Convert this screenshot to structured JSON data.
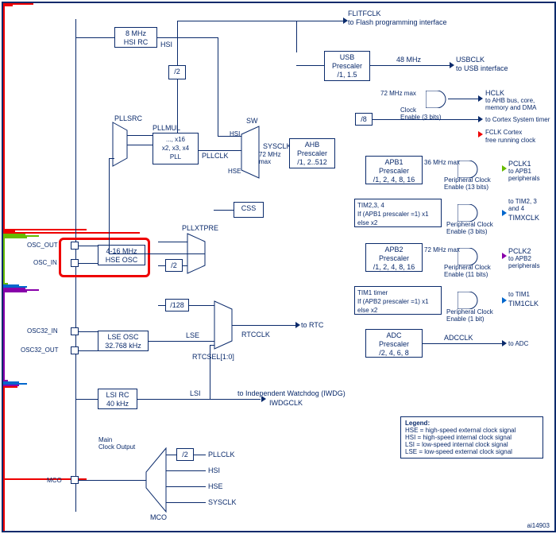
{
  "diagram_id": "ai14903",
  "sources": {
    "hsi": {
      "name": "8 MHz\nHSI RC",
      "signal": "HSI"
    },
    "hse": {
      "name": "4-16 MHz\nHSE OSC",
      "signal": "HSE",
      "pins": [
        "OSC_OUT",
        "OSC_IN"
      ]
    },
    "lse": {
      "name": "LSE OSC\n32.768 kHz",
      "signal": "LSE",
      "pins": [
        "OSC32_IN",
        "OSC32_OUT"
      ]
    },
    "lsi": {
      "name": "LSI RC\n40 kHz",
      "signal": "LSI"
    }
  },
  "dividers": {
    "hsi_div2": "/2",
    "hse_div2": "/2",
    "hse_div128": "/128",
    "cortex_div8": "/8",
    "mco_div2": "/2"
  },
  "muxes": {
    "pllsrc": "PLLSRC",
    "pllxtpre": "PLLXTPRE",
    "sw": "SW",
    "rtcsel": "RTCSEL[1:0]",
    "mco": "MCO"
  },
  "pll": {
    "label": "PLLMUL",
    "text": "..., x16\nx2, x3, x4\nPLL",
    "out": "PLLCLK"
  },
  "css": "CSS",
  "sysclk": {
    "name": "SYSCLK",
    "max": "72 MHz\nmax"
  },
  "prescalers": {
    "usb": {
      "name": "USB\nPrescaler\n/1, 1.5"
    },
    "ahb": {
      "name": "AHB\nPrescaler\n/1, 2..512"
    },
    "apb1": {
      "name": "APB1\nPrescaler\n/1, 2, 4, 8, 16",
      "max": "36 MHz max"
    },
    "apb2": {
      "name": "APB2\nPrescaler\n/1, 2, 4, 8, 16",
      "max": "72 MHz max"
    },
    "adc": {
      "name": "ADC\nPrescaler\n/2, 4, 6, 8"
    }
  },
  "tim_logic": {
    "tim234": "TIM2,3, 4\nIf (APB1 prescaler =1) x1\nelse                       x2",
    "tim1": "TIM1 timer\nIf (APB2 prescaler =1) x1\nelse                       x2"
  },
  "outputs": {
    "flitfclk": {
      "sig": "FLITFCLK",
      "dest": "to Flash programming interface"
    },
    "usbclk": {
      "sig": "USBCLK",
      "freq": "48 MHz",
      "dest": "to USB interface"
    },
    "hclk": {
      "sig": "HCLK",
      "max": "72 MHz max",
      "dest": "to AHB bus, core,\nmemory and DMA",
      "enable": "Clock\nEnable (3 bits)"
    },
    "cortex": {
      "dest": "to Cortex System timer"
    },
    "fclk": {
      "sig": "FCLK Cortex",
      "dest": "free running clock"
    },
    "pclk1": {
      "sig": "PCLK1",
      "dest": "to APB1\nperipherals",
      "enable": "Peripheral Clock\nEnable (13 bits)"
    },
    "timxclk": {
      "sig": "TIMXCLK",
      "dest": "to TIM2, 3\nand 4",
      "enable": "Peripheral Clock\nEnable (3 bits)"
    },
    "pclk2": {
      "sig": "PCLK2",
      "dest": "to APB2\nperipherals",
      "enable": "Peripheral Clock\nEnable (11 bits)"
    },
    "tim1clk": {
      "sig": "TIM1CLK",
      "dest": "to TIM1",
      "enable": "Peripheral Clock\nEnable (1 bit)"
    },
    "adcclk": {
      "sig": "ADCCLK",
      "dest": "to ADC"
    },
    "rtcclk": {
      "sig": "RTCCLK",
      "dest": "to RTC"
    },
    "iwdgclk": {
      "sig": "IWDGCLK",
      "dest": "to Independent Watchdog (IWDG)"
    }
  },
  "mco": {
    "label": "Main\nClock Output",
    "pin": "MCO",
    "options": [
      "PLLCLK",
      "HSI",
      "HSE",
      "SYSCLK"
    ]
  },
  "legend": {
    "title": "Legend:",
    "lines": [
      "HSE = high-speed external clock signal",
      "HSI = high-speed internal clock signal",
      "LSI = low-speed internal clock signal",
      "LSE = low-speed external clock signal"
    ]
  }
}
